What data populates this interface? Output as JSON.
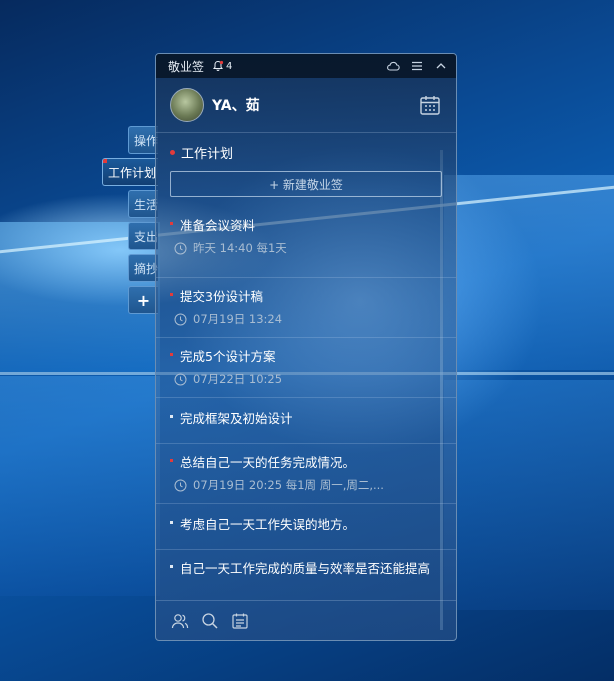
{
  "side_tabs": [
    {
      "label": "操作",
      "active": false
    },
    {
      "label": "工作计划",
      "active": true
    },
    {
      "label": "生活",
      "active": false
    },
    {
      "label": "支出",
      "active": false
    },
    {
      "label": "摘抄",
      "active": false
    },
    {
      "label": "+",
      "active": false
    }
  ],
  "titlebar": {
    "title": "敬业签",
    "notification_count": "4"
  },
  "user": {
    "name": "YA、茹"
  },
  "section": {
    "title": "工作计划"
  },
  "new_button": {
    "label": "+ 新建敬业签"
  },
  "items": [
    {
      "title": "准备会议资料",
      "meta": "昨天 14:40 每1天",
      "color": "#e23b3b"
    },
    {
      "title": "提交3份设计稿",
      "meta": "07月19日 13:24",
      "color": "#e23b3b"
    },
    {
      "title": "完成5个设计方案",
      "meta": "07月22日 10:25",
      "color": "#e23b3b"
    },
    {
      "title": "完成框架及初始设计",
      "meta": "",
      "color": "#dfe9f4"
    },
    {
      "title": "总结自己一天的任务完成情况。",
      "meta": "07月19日 20:25 每1周 周一,周二,...",
      "color": "#e23b3b"
    },
    {
      "title": "考虑自己一天工作失误的地方。",
      "meta": "",
      "color": "#dfe9f4"
    },
    {
      "title": "自己一天工作完成的质量与效率是否还能提高",
      "meta": "",
      "color": "#dfe9f4"
    }
  ],
  "icons": {
    "bell": "bell-icon",
    "cloud": "cloud-icon",
    "menu": "menu-icon",
    "collapse": "chevron-up-icon",
    "calendar": "calendar-icon",
    "clock": "clock-icon",
    "contacts": "users-icon",
    "search": "search-icon",
    "notes": "notes-icon"
  }
}
